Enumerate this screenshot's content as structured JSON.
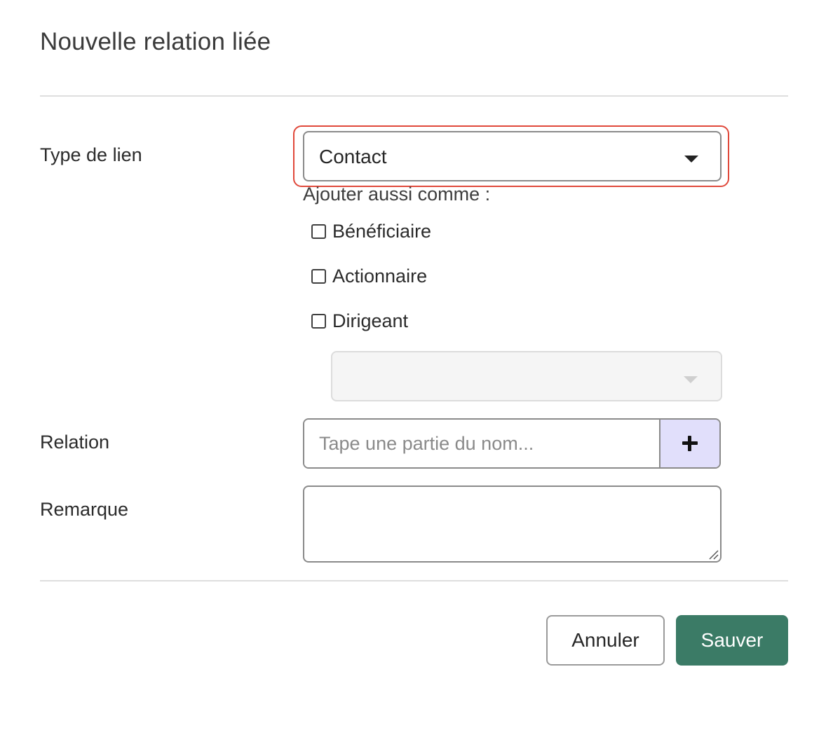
{
  "dialog": {
    "title": "Nouvelle relation liée"
  },
  "form": {
    "link_type": {
      "label": "Type de lien",
      "selected": "Contact"
    },
    "also_add_as": {
      "label": "Ajouter aussi comme :",
      "options": [
        {
          "label": "Bénéficiaire",
          "checked": false
        },
        {
          "label": "Actionnaire",
          "checked": false
        },
        {
          "label": "Dirigeant",
          "checked": false
        }
      ],
      "sub_select_value": ""
    },
    "relation": {
      "label": "Relation",
      "placeholder": "Tape une partie du nom...",
      "value": ""
    },
    "remark": {
      "label": "Remarque",
      "value": ""
    }
  },
  "buttons": {
    "cancel": "Annuler",
    "save": "Sauver"
  },
  "colors": {
    "focus_ring": "#e0483a",
    "primary": "#3b7b66",
    "add_button_bg": "#e1dffb"
  },
  "icons": {
    "dropdown": "chevron-down-icon",
    "add": "plus-icon",
    "resize": "resize-handle-icon"
  }
}
